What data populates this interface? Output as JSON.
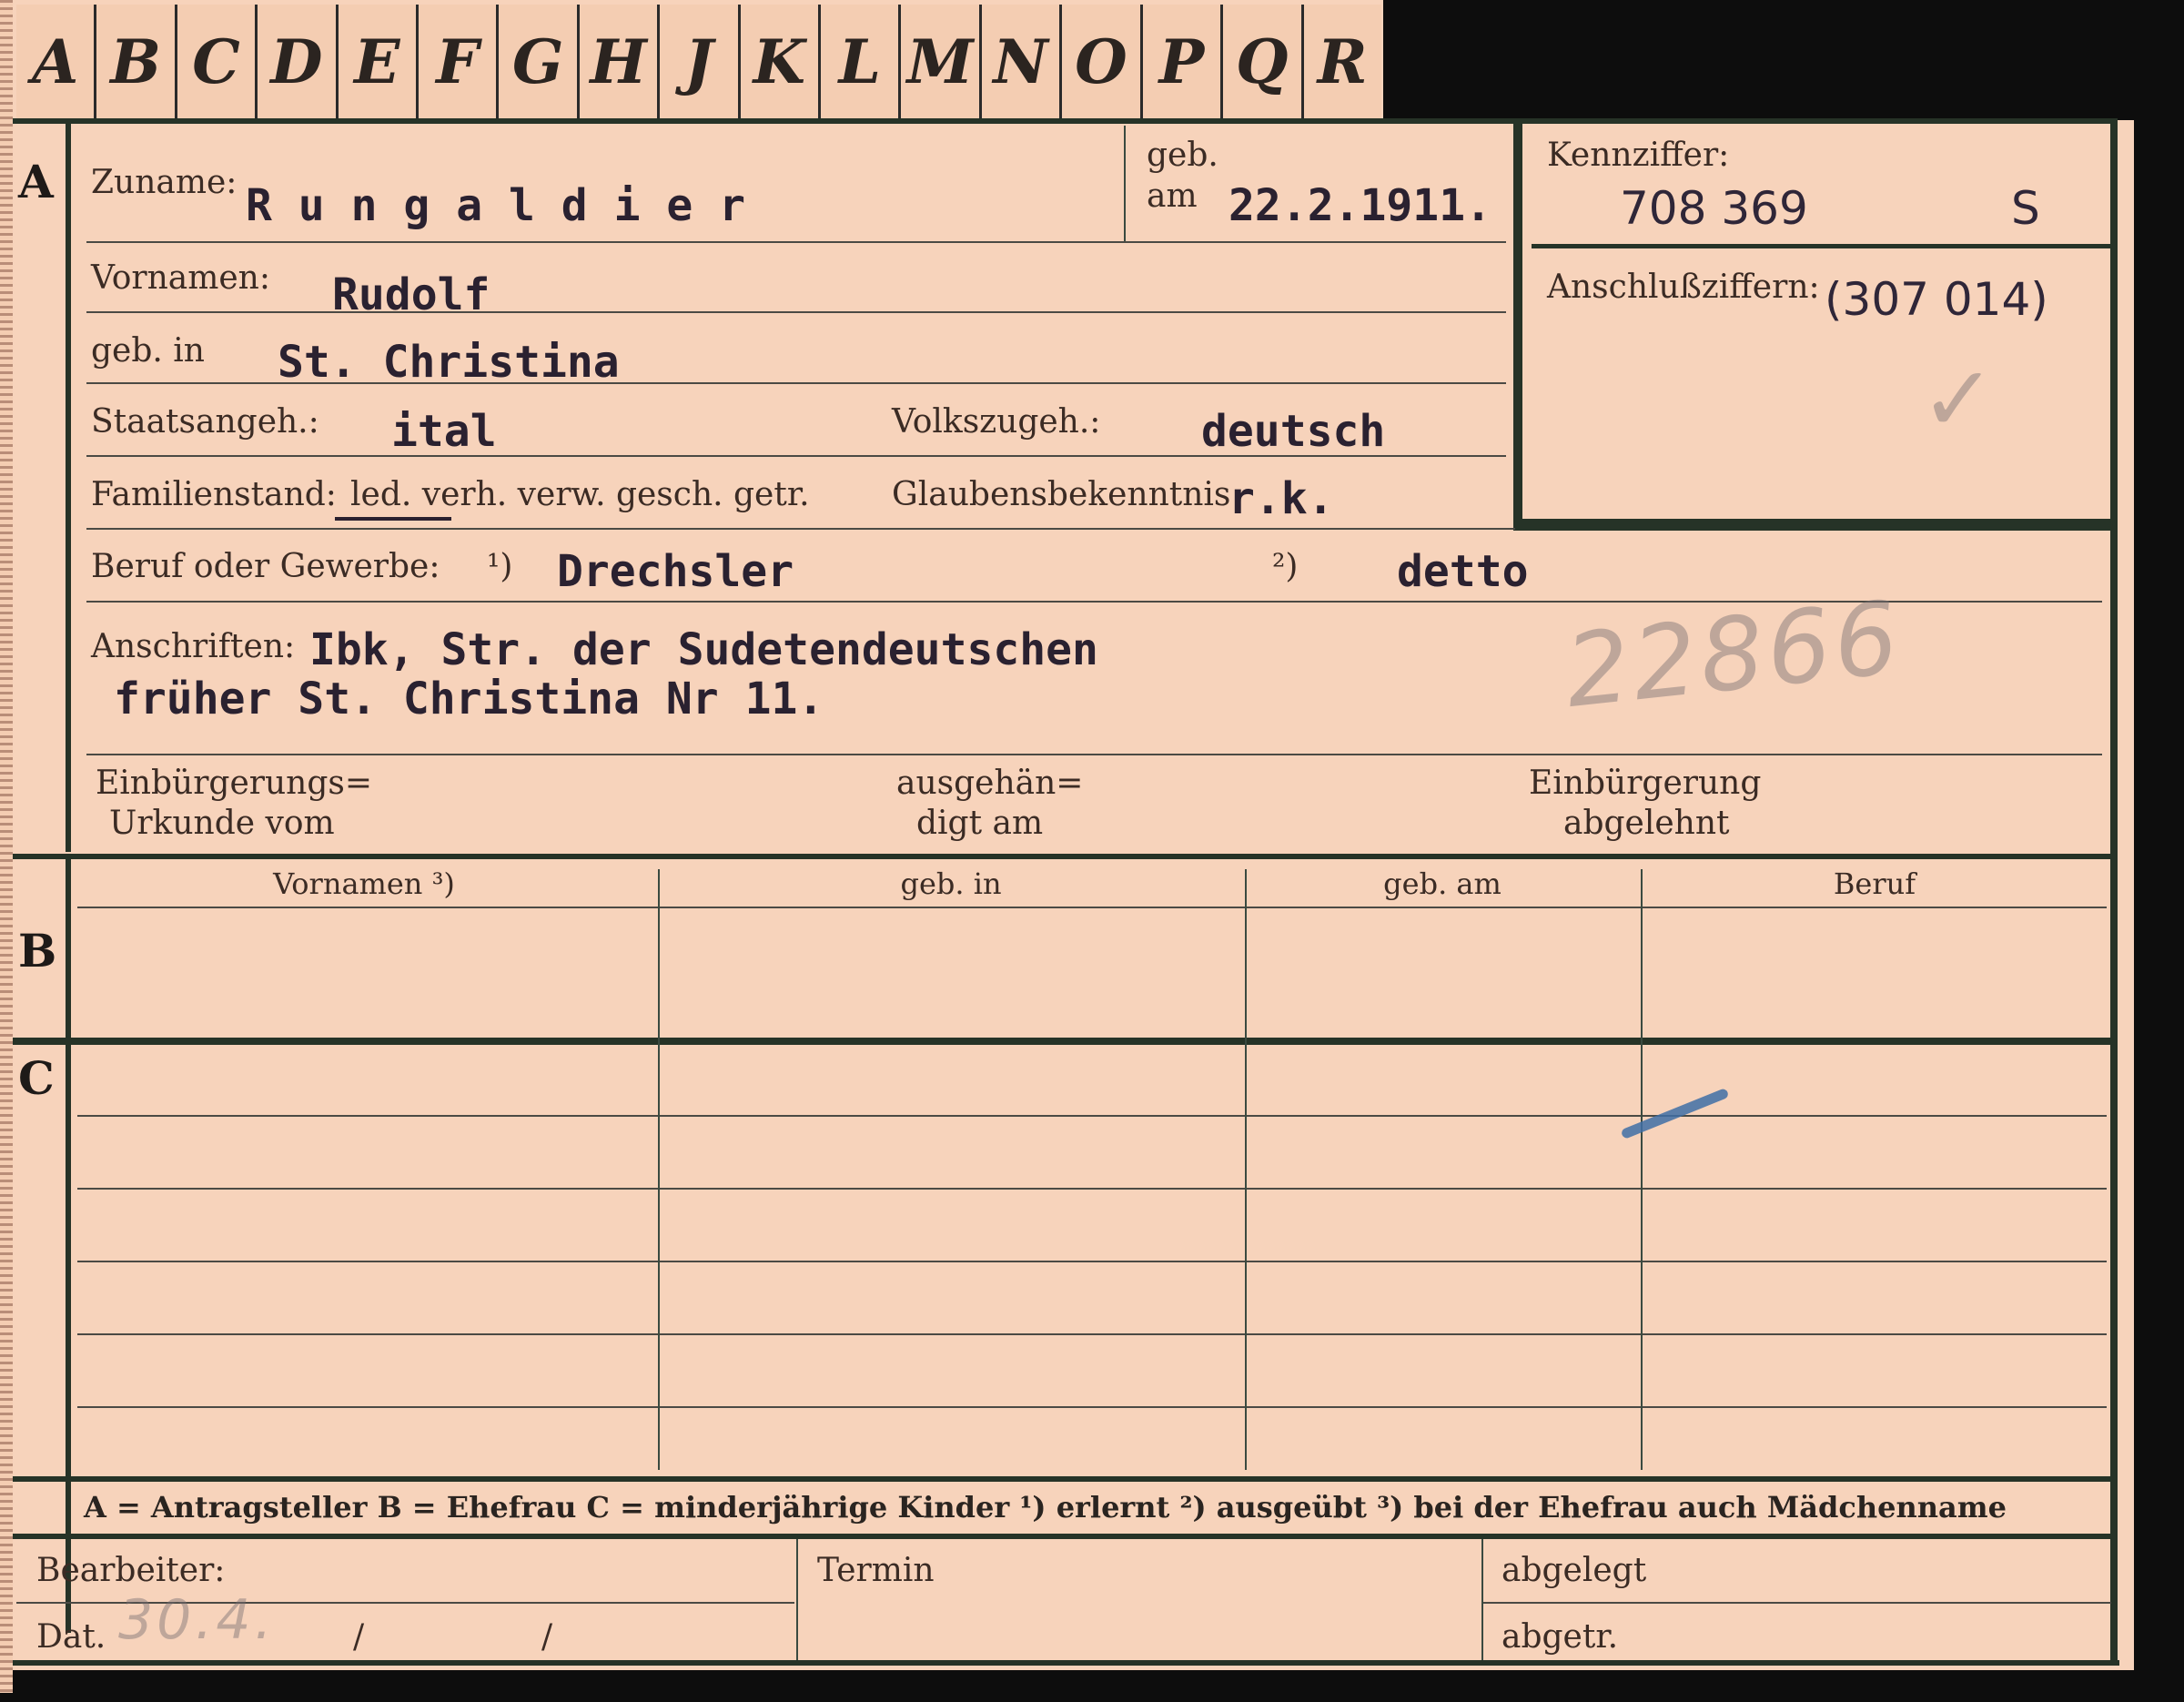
{
  "tabs": [
    "A",
    "B",
    "C",
    "D",
    "E",
    "F",
    "G",
    "H",
    "J",
    "K",
    "L",
    "M",
    "N",
    "O",
    "P",
    "Q",
    "R"
  ],
  "section_a": {
    "letter": "A",
    "surname_label": "Zuname:",
    "surname": "R u n g a l d i e r",
    "born_label_1": "geb.",
    "born_label_2": "am",
    "born_date": "22.2.1911.",
    "given_label": "Vornamen:",
    "given": "Rudolf",
    "birthplace_label": "geb. in",
    "birthplace": "St. Christina",
    "citizenship_label": "Staatsangeh.:",
    "citizenship": "ital",
    "ethnicity_label": "Volkszugeh.:",
    "ethnicity": "deutsch",
    "marital_label": "Familienstand:",
    "marital_options": "led. verh. verw. gesch. getr.",
    "religion_label": "Glaubensbekenntnis",
    "religion": "r.k.",
    "occupation_label": "Beruf oder Gewerbe:",
    "occupation_note_1": "¹)",
    "occupation": "Drechsler",
    "occupation_note_2": "²)",
    "occupation_practiced": "detto",
    "address_label": "Anschriften:",
    "address_line_1": "Ibk, Str. der Sudetendeutschen",
    "address_line_2": "früher St. Christina Nr 11.",
    "pencil_number": "22866",
    "naturalization_label_1": "Einbürgerungs=",
    "naturalization_label_2": "Urkunde vom",
    "handed_label_1": "ausgehän=",
    "handed_label_2": "digt am",
    "rejected_label_1": "Einbürgerung",
    "rejected_label_2": "abgelehnt"
  },
  "reference": {
    "label": "Kennziffer:",
    "number": "708 369",
    "suffix": "S",
    "connection_label": "Anschlußziffern:",
    "connection_number": "(307 014)",
    "check_mark": "✓"
  },
  "section_b": {
    "letter": "B",
    "columns": [
      "Vornamen ³)",
      "geb. in",
      "geb. am",
      "Beruf"
    ]
  },
  "section_c": {
    "letter": "C"
  },
  "legend": "A = Antragsteller   B = Ehefrau   C = minderjährige Kinder   ¹) erlernt   ²) ausgeübt   ³) bei der Ehefrau auch Mädchenname",
  "footer": {
    "clerk_label": "Bearbeiter:",
    "date_label": "Dat.",
    "date_value": "30.4.",
    "slash_1": "/",
    "slash_2": "/",
    "deadline_label": "Termin",
    "filed_label": "abgelegt",
    "separated_label": "abgetr."
  },
  "colors": {
    "paper": "#f7d3bb",
    "ink": "#2a2130",
    "rule": "#263327"
  }
}
